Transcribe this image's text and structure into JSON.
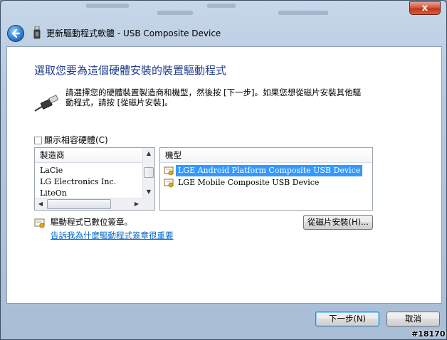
{
  "window": {
    "title": "更新驅動程式軟體 - USB Composite Device",
    "close_label": "x"
  },
  "content": {
    "heading": "選取您要為這個硬體安裝的裝置驅動程式",
    "instruction_line1": "請選擇您的硬體裝置製造商和機型，然後按 [下一步]。如果您想從磁片安裝其他驅",
    "instruction_line2": "動程式，請按 [從磁片安裝]。",
    "show_compatible_label": "顯示相容硬體(C)",
    "show_compatible_checked": false
  },
  "manufacturer_list": {
    "header": "製造商",
    "items": [
      "LaCie",
      "LG Electronics Inc.",
      "LiteOn"
    ]
  },
  "model_list": {
    "header": "機型",
    "items": [
      {
        "label": "LGE Android Platform Composite USB Device",
        "selected": true
      },
      {
        "label": "LGE Mobile Composite USB Device",
        "selected": false
      }
    ]
  },
  "signature": {
    "status_text": "驅動程式已數位簽章。",
    "link_text": "告訴我為什麼驅動程式簽章很重要"
  },
  "buttons": {
    "have_disk": "從磁片安裝(H)...",
    "next": "下一步(N)",
    "cancel": "取消"
  },
  "watermark": "#18170",
  "colors": {
    "heading": "#1f3c8c",
    "link": "#0066cc",
    "selection": "#3399ff"
  }
}
